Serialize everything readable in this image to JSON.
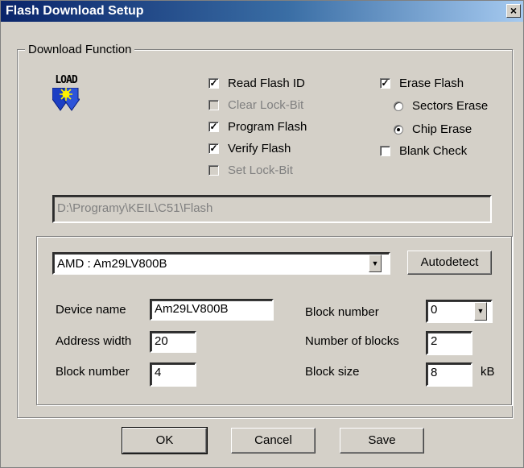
{
  "window": {
    "title": "Flash Download Setup",
    "close_glyph": "×"
  },
  "download_function": {
    "legend": "Download Function",
    "load_icon_text": "LOAD",
    "checks": {
      "read_flash_id": {
        "label": "Read Flash ID",
        "checked": true
      },
      "clear_lock_bit": {
        "label": "Clear Lock-Bit",
        "checked": false,
        "disabled": true
      },
      "program_flash": {
        "label": "Program Flash",
        "checked": true
      },
      "verify_flash": {
        "label": "Verify Flash",
        "checked": true
      },
      "set_lock_bit": {
        "label": "Set Lock-Bit",
        "checked": false,
        "disabled": true
      },
      "erase_flash": {
        "label": "Erase Flash",
        "checked": true
      },
      "blank_check": {
        "label": "Blank Check",
        "checked": false
      }
    },
    "radios": {
      "sectors_erase": {
        "label": "Sectors Erase",
        "selected": false
      },
      "chip_erase": {
        "label": "Chip Erase",
        "selected": true
      }
    },
    "path_value": "D:\\Programy\\KEIL\\C51\\Flash",
    "check_glyph": "✓"
  },
  "device": {
    "selected_device": "AMD : Am29LV800B",
    "autodetect_label": "Autodetect",
    "device_name_label": "Device name",
    "device_name_value": "Am29LV800B",
    "address_width_label": "Address width",
    "address_width_value": "20",
    "block_number_left_label": "Block number",
    "block_number_left_value": "4",
    "block_number_right_label": "Block number",
    "block_number_right_value": "0",
    "num_blocks_label": "Number of blocks",
    "num_blocks_value": "2",
    "block_size_label": "Block size",
    "block_size_value": "8",
    "block_size_unit": "kB",
    "dropdown_glyph": "▼"
  },
  "buttons": {
    "ok": "OK",
    "cancel": "Cancel",
    "save": "Save"
  }
}
